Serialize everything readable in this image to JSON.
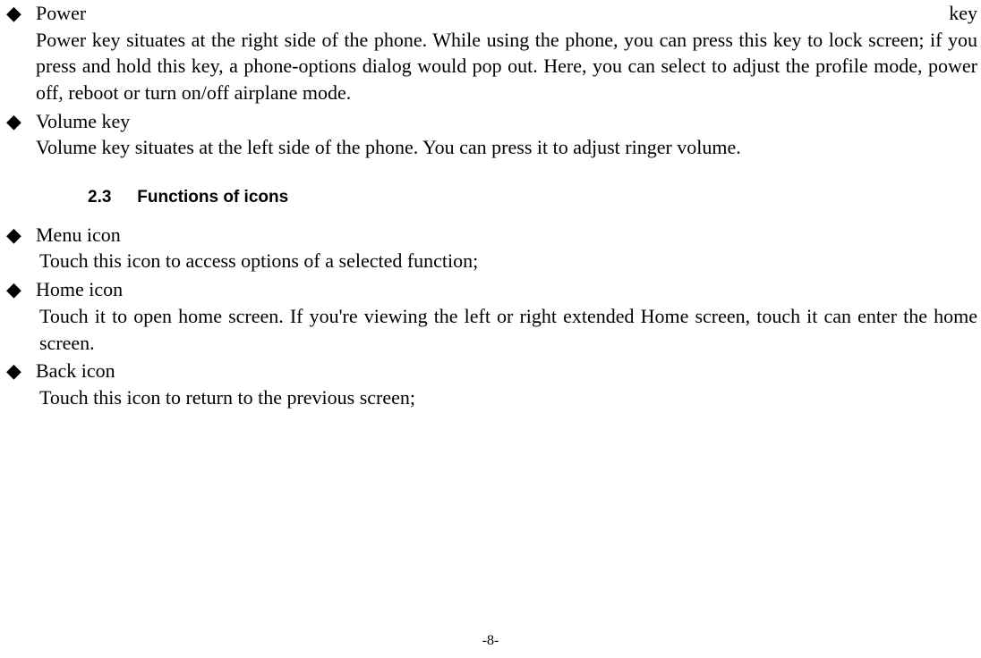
{
  "items1": [
    {
      "titleLeft": "Power",
      "titleRight": "key",
      "body": "Power key situates at the right side of the phone. While using the phone, you can press this key to lock screen; if you press and hold this key, a phone-options dialog would pop out. Here, you can select to adjust the profile mode, power off, reboot or turn on/off airplane mode."
    },
    {
      "titleLeft": "Volume key",
      "titleRight": "",
      "body": "Volume key situates at the left side of the phone. You can press it to adjust ringer volume."
    }
  ],
  "section": {
    "number": "2.3",
    "title": "Functions of icons"
  },
  "items2": [
    {
      "title": "Menu icon",
      "body": "Touch this icon to access options of a selected function;"
    },
    {
      "title": "Home icon",
      "body": "Touch it to open home screen. If you're viewing the left or right extended Home screen, touch it can enter the home screen."
    },
    {
      "title": "Back icon",
      "body": "Touch this icon to return to the previous screen;"
    }
  ],
  "pageNumber": "-8-"
}
